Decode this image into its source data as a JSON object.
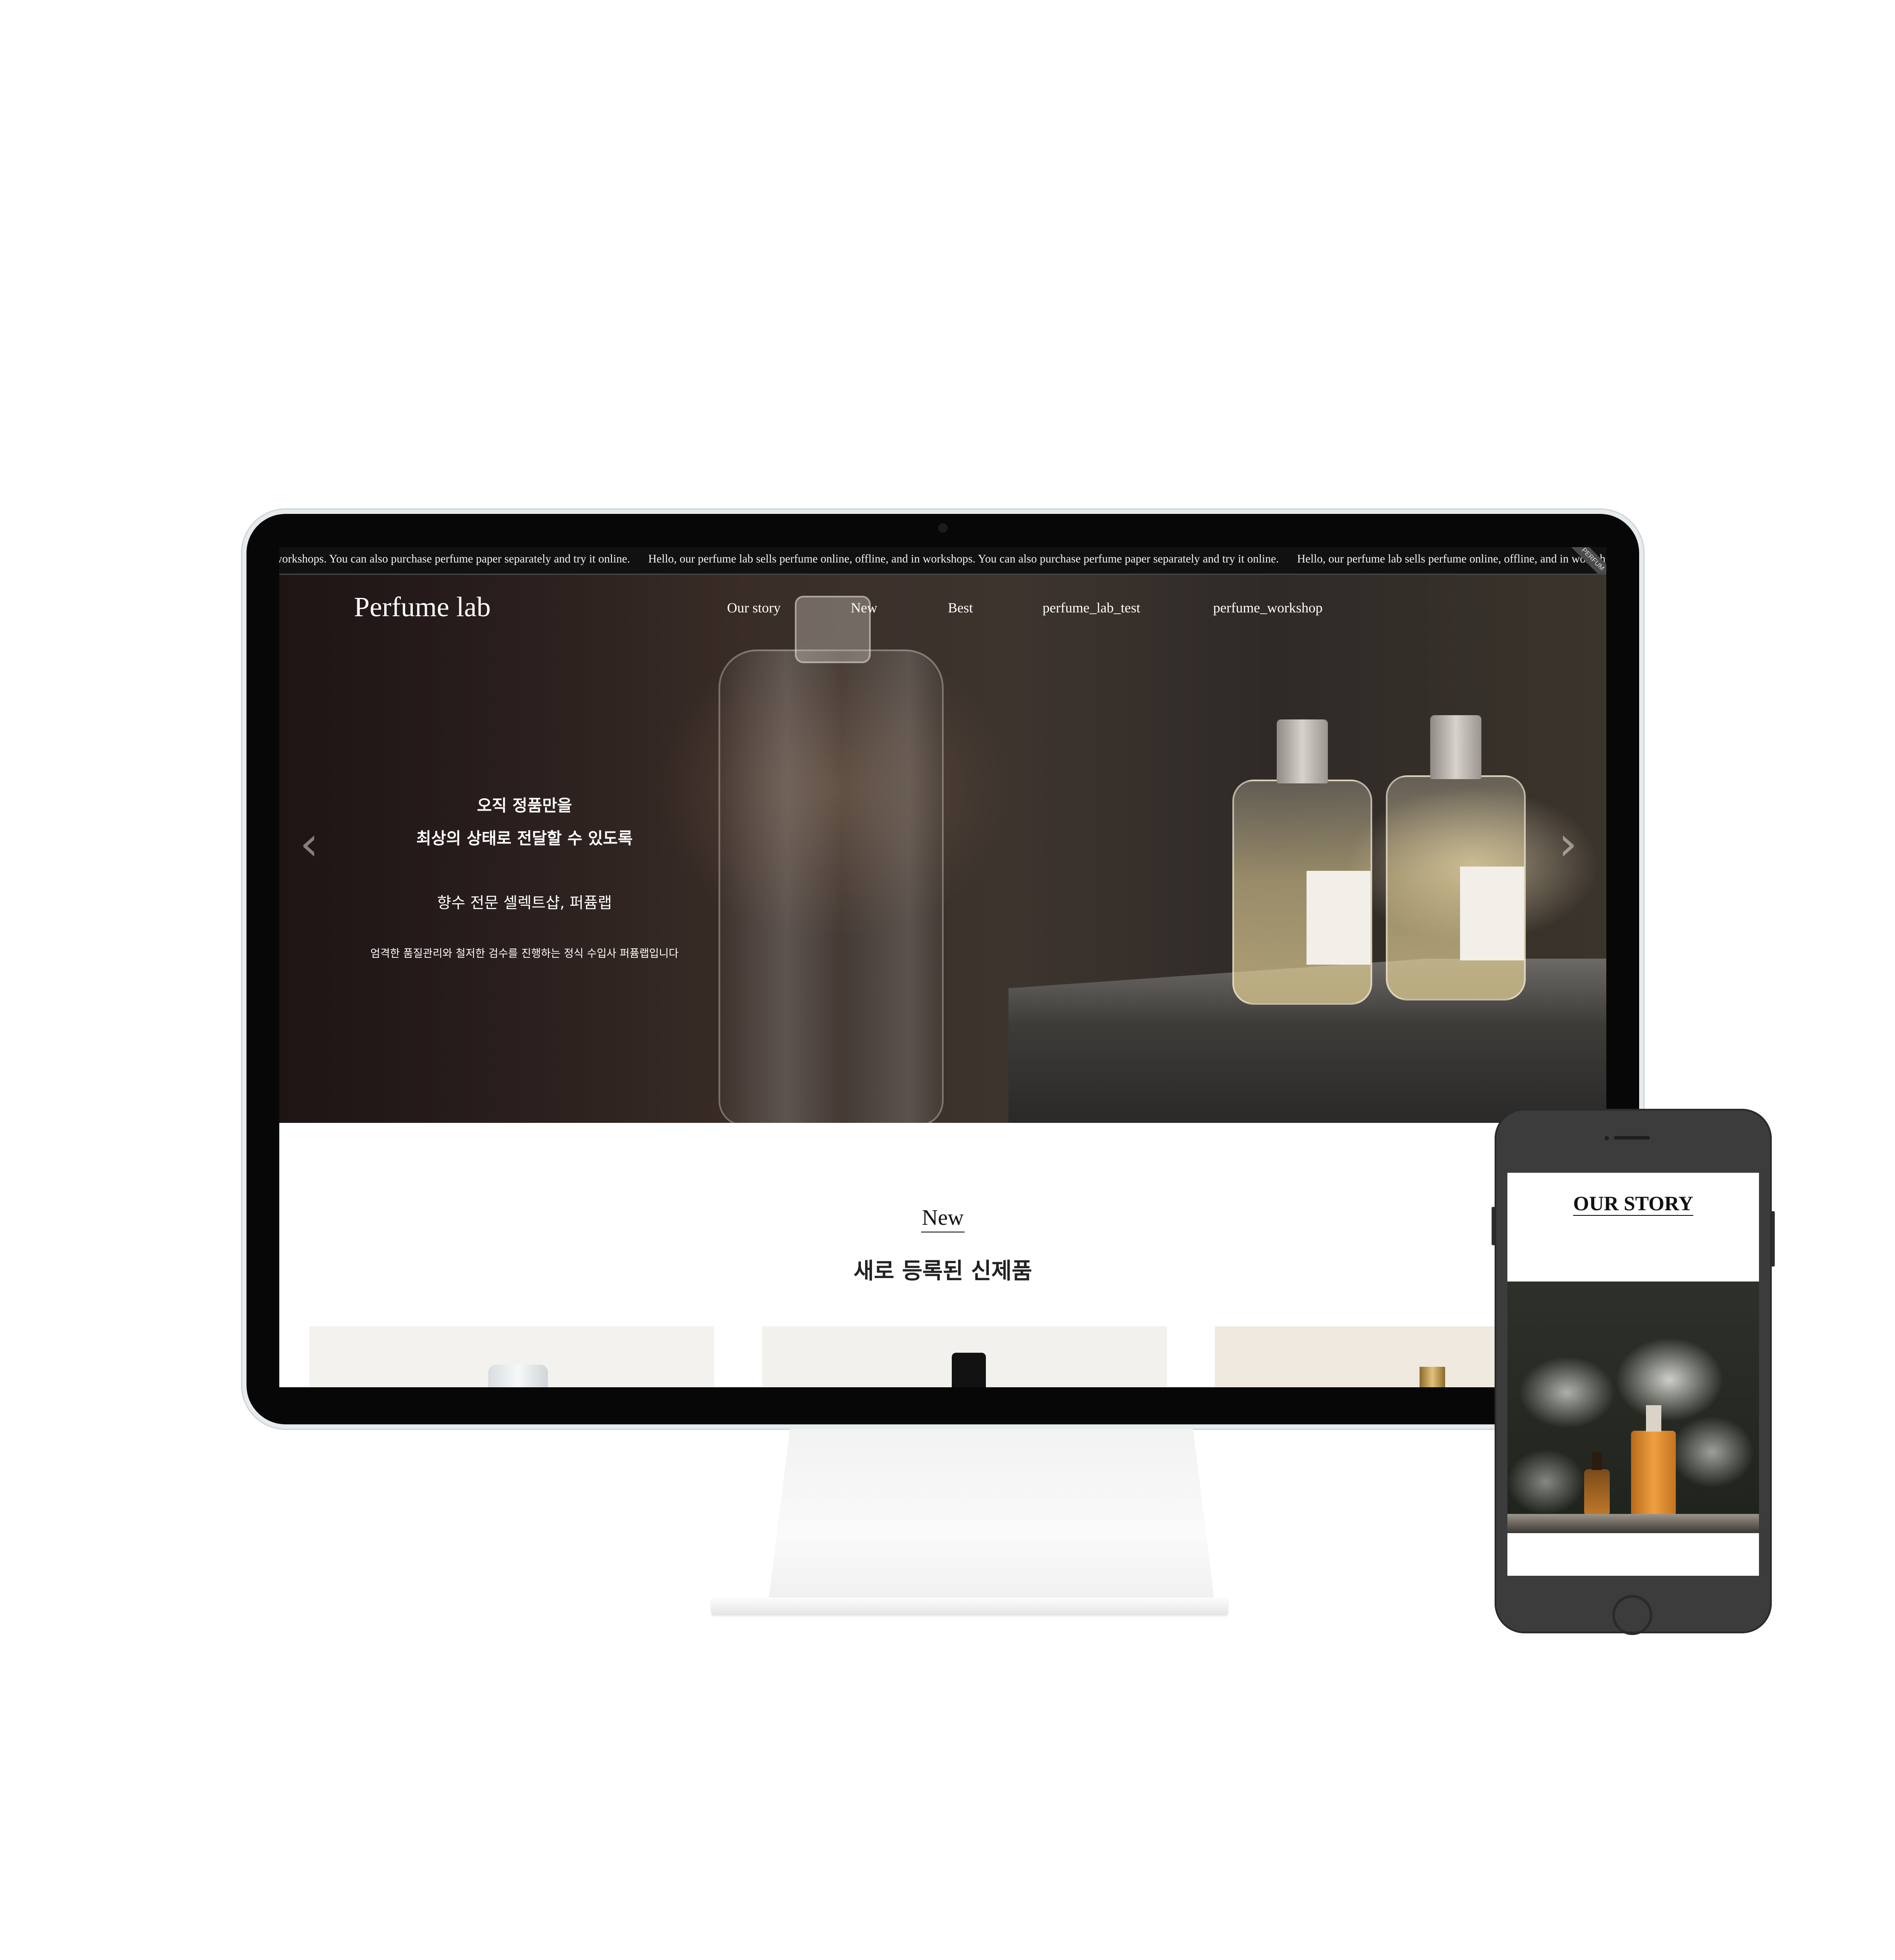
{
  "marquee": {
    "segments": [
      "s workshops. You can also purchase perfume paper separately and try it online.",
      "Hello, our perfume lab sells perfume online, offline, and in workshops. You can also purchase perfume paper separately and try it online.",
      "Hello, our perfume lab sells perfume online, offline, and in worksh"
    ],
    "corner_label": "PERFUM"
  },
  "header": {
    "logo": "Perfume lab",
    "nav": [
      "Our story",
      "New",
      "Best",
      "perfume_lab_test",
      "perfume_workshop"
    ]
  },
  "hero": {
    "line1": "오직 정품만을",
    "line2": "최상의 상태로 전달할 수 있도록",
    "subtitle": "향수 전문 셀렉트샵, 퍼퓸랩",
    "description": "엄격한 품질관리와 철저한 검수를 진행하는 정식 수입사 퍼퓸랩입니다",
    "prev_icon": "chevron-left-icon",
    "next_icon": "chevron-right-icon"
  },
  "new_section": {
    "label": "New",
    "subtitle": "새로 등록된 신제품"
  },
  "phone": {
    "story_title": "OUR STORY"
  },
  "colors": {
    "background": "#ffffff",
    "monitor_frame": "#070707",
    "phone_body": "#3c3c3c",
    "text_dark": "#111111",
    "hero_text": "#ffffff"
  }
}
